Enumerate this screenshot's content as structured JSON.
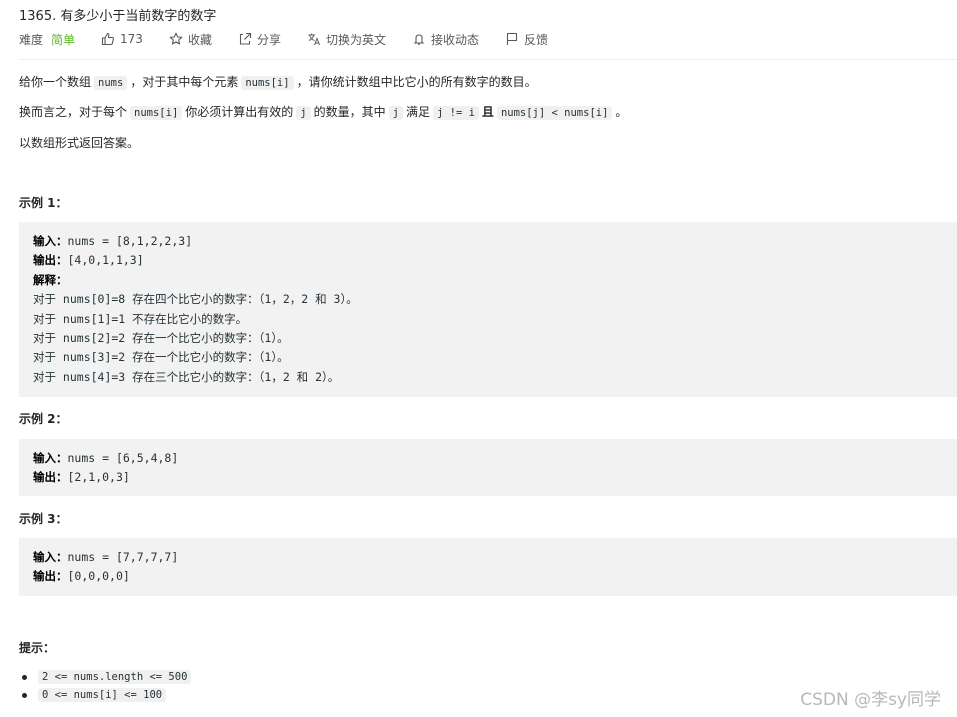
{
  "problem": {
    "title": "1365. 有多少小于当前数字的数字",
    "difficulty_label": "难度",
    "difficulty": "简单",
    "likes": "173",
    "actions": [
      "收藏",
      "分享",
      "切换为英文",
      "接收动态",
      "反馈"
    ]
  },
  "description": {
    "p1_a": "给你一个数组",
    "p1_code1": "nums",
    "p1_b": "，对于其中每个元素",
    "p1_code2": "nums[i]",
    "p1_c": "，请你统计数组中比它小的所有数字的数目。",
    "p2_a": "换而言之，对于每个",
    "p2_code1": "nums[i]",
    "p2_b": "你必须计算出有效的",
    "p2_code2": "j",
    "p2_c": "的数量，其中",
    "p2_code3": "j",
    "p2_d": "满足",
    "p2_code4": "j != i",
    "p2_e": "且",
    "p2_code5": "nums[j] < nums[i]",
    "p2_f": "。",
    "p3": "以数组形式返回答案。"
  },
  "examples": [
    {
      "heading": "示例 1：",
      "input_label": "输入：",
      "input": "nums = [8,1,2,2,3]",
      "output_label": "输出：",
      "output": "[4,0,1,1,3]",
      "explain_label": "解释：",
      "explain": [
        "对于 nums[0]=8 存在四个比它小的数字：（1，2，2 和 3）。",
        "对于 nums[1]=1 不存在比它小的数字。",
        "对于 nums[2]=2 存在一个比它小的数字：（1）。",
        "对于 nums[3]=2 存在一个比它小的数字：（1）。",
        "对于 nums[4]=3 存在三个比它小的数字：（1，2 和 2）。"
      ]
    },
    {
      "heading": "示例 2：",
      "input_label": "输入：",
      "input": "nums = [6,5,4,8]",
      "output_label": "输出：",
      "output": "[2,1,0,3]"
    },
    {
      "heading": "示例 3：",
      "input_label": "输入：",
      "input": "nums = [7,7,7,7]",
      "output_label": "输出：",
      "output": "[0,0,0,0]"
    }
  ],
  "tips": {
    "heading": "提示：",
    "items": [
      "2 <= nums.length <= 500",
      "0 <= nums[i] <= 100"
    ]
  },
  "watermark": "CSDN @李sy同学",
  "colors": {
    "easy": "#5ab726",
    "code_bg": "#f2f2f2"
  }
}
